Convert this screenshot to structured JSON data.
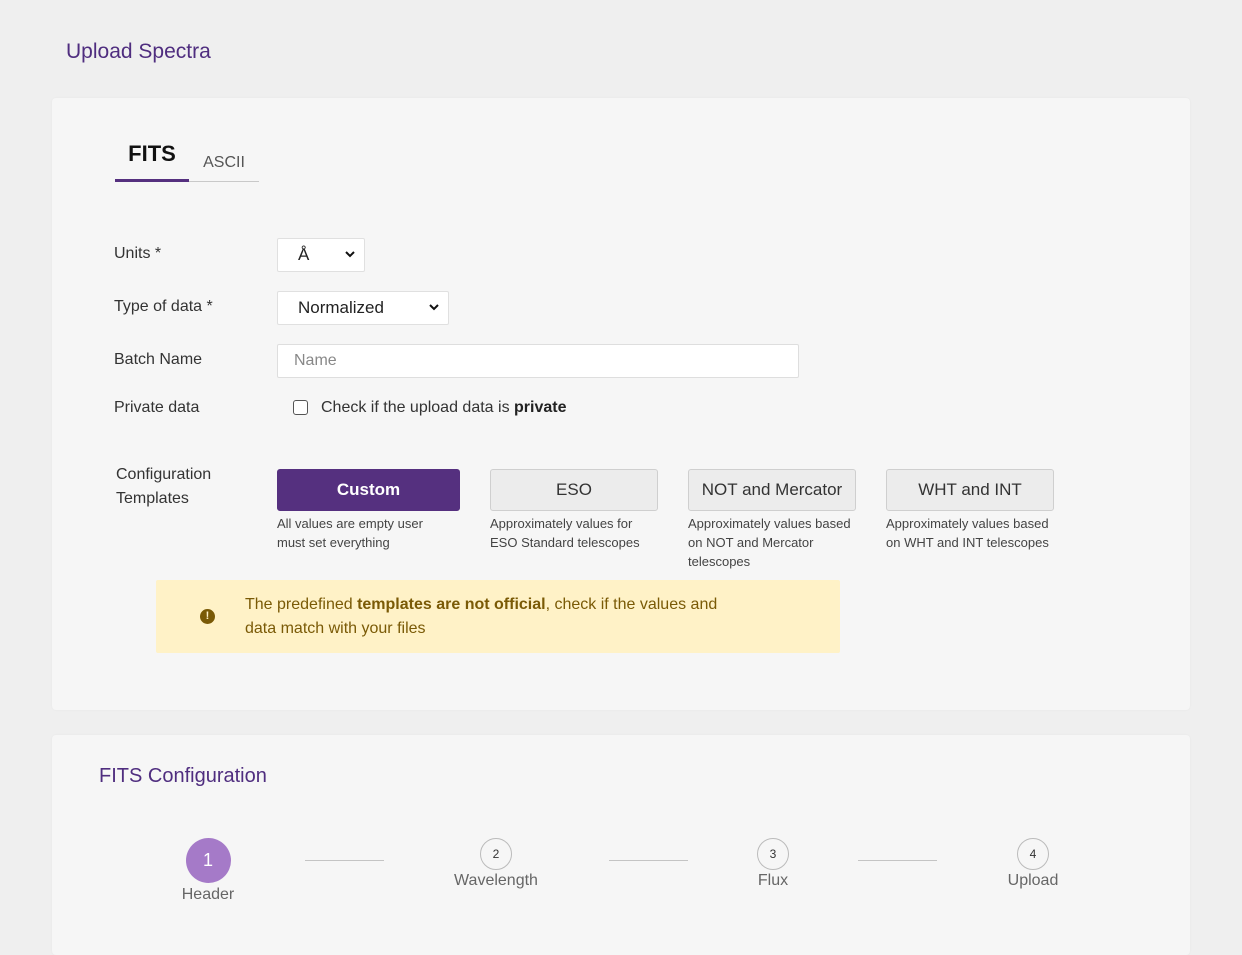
{
  "page": {
    "title": "Upload Spectra"
  },
  "tabs": [
    {
      "label": "FITS",
      "active": true
    },
    {
      "label": "ASCII",
      "active": false
    }
  ],
  "form": {
    "units": {
      "label": "Units *",
      "value": "Å"
    },
    "type_of_data": {
      "label": "Type of data *",
      "value": "Normalized"
    },
    "batch_name": {
      "label": "Batch Name",
      "value": "",
      "placeholder": "Name"
    },
    "private_data": {
      "label": "Private data",
      "checked": false,
      "text_prefix": "Check if the upload data is ",
      "text_bold": "private"
    },
    "templates": {
      "label_line1": "Configuration",
      "label_line2": "Templates",
      "items": [
        {
          "label": "Custom",
          "active": true,
          "desc_line1": "All values are empty user",
          "desc_line2": "must set everything",
          "desc_line3": ""
        },
        {
          "label": "ESO",
          "active": false,
          "desc_line1": "Approximately values for",
          "desc_line2": "ESO Standard telescopes",
          "desc_line3": ""
        },
        {
          "label": "NOT and Mercator",
          "active": false,
          "desc_line1": "Approximately values based",
          "desc_line2": "on NOT and Mercator",
          "desc_line3": "telescopes"
        },
        {
          "label": "WHT and INT",
          "active": false,
          "desc_line1": "Approximately values based",
          "desc_line2": "on WHT and INT telescopes",
          "desc_line3": ""
        }
      ]
    },
    "alert": {
      "icon": "exclamation-circle-icon",
      "prefix": "The predefined ",
      "bold": "templates are not official",
      "suffix_line1": ", check if the values and",
      "line2": "data match with your files"
    }
  },
  "fits_config": {
    "title": "FITS Configuration",
    "current_step": 1,
    "steps": [
      {
        "number": "1",
        "label": "Header"
      },
      {
        "number": "2",
        "label": "Wavelength"
      },
      {
        "number": "3",
        "label": "Flux"
      },
      {
        "number": "4",
        "label": "Upload"
      }
    ]
  },
  "colors": {
    "brand_purple": "#55307f",
    "step_active": "#a57ac8",
    "alert_bg": "#fff2c7",
    "alert_text": "#7a5a06"
  }
}
